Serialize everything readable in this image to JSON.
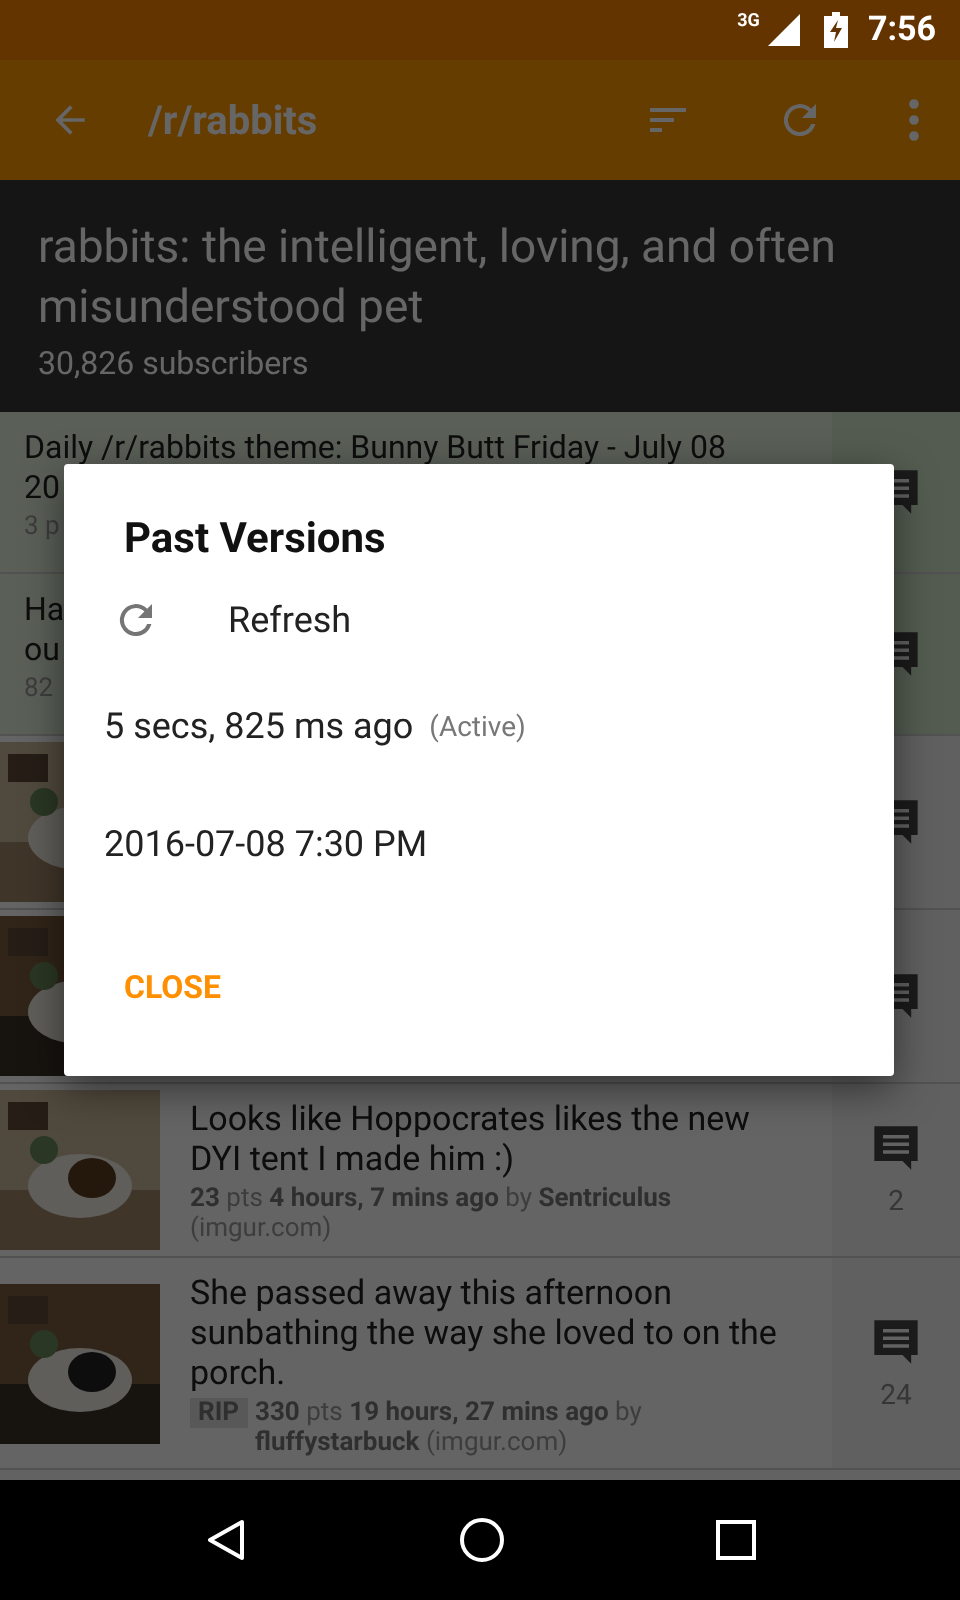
{
  "status_bar": {
    "network": "3G",
    "time": "7:56"
  },
  "toolbar": {
    "title": "/r/rabbits"
  },
  "header": {
    "title": "rabbits: the intelligent, loving, and often misunderstood pet",
    "subscribers": "30,826 subscribers"
  },
  "posts": [
    {
      "kind": "text",
      "stickied": true,
      "title_lines": [
        "Daily /r/rabbits theme: Bunny Butt Friday - July 08",
        "20"
      ],
      "meta": "3 p"
    },
    {
      "kind": "text",
      "stickied": true,
      "title_lines": [
        "Ha",
        "ou"
      ],
      "meta": "82"
    },
    {
      "kind": "thumbnail",
      "stickied": false
    },
    {
      "kind": "thumbnail",
      "stickied": false
    },
    {
      "kind": "thumbnail",
      "stickied": false,
      "title_lines": [
        "Looks like Hoppocrates likes the new DYI tent I made him :)"
      ],
      "meta": "**23** pts **4 hours, 7 mins ago** by **Sentriculus** (imgur.com)",
      "comments": "2"
    },
    {
      "kind": "thumbnail",
      "stickied": false,
      "flair": "RIP",
      "title_lines": [
        "She passed away this afternoon sunbathing the way she loved to on the porch."
      ],
      "meta": "**330** pts **19 hours, 27 mins ago** by **fluffystarbuck** (imgur.com)",
      "comments": "24"
    }
  ],
  "dialog": {
    "title": "Past Versions",
    "items": [
      {
        "kind": "action",
        "label": "Refresh"
      },
      {
        "kind": "version",
        "label": "5 secs, 825 ms ago",
        "note": "(Active)"
      },
      {
        "kind": "version",
        "label": "2016-07-08 7:30 PM"
      }
    ],
    "button": "CLOSE"
  }
}
